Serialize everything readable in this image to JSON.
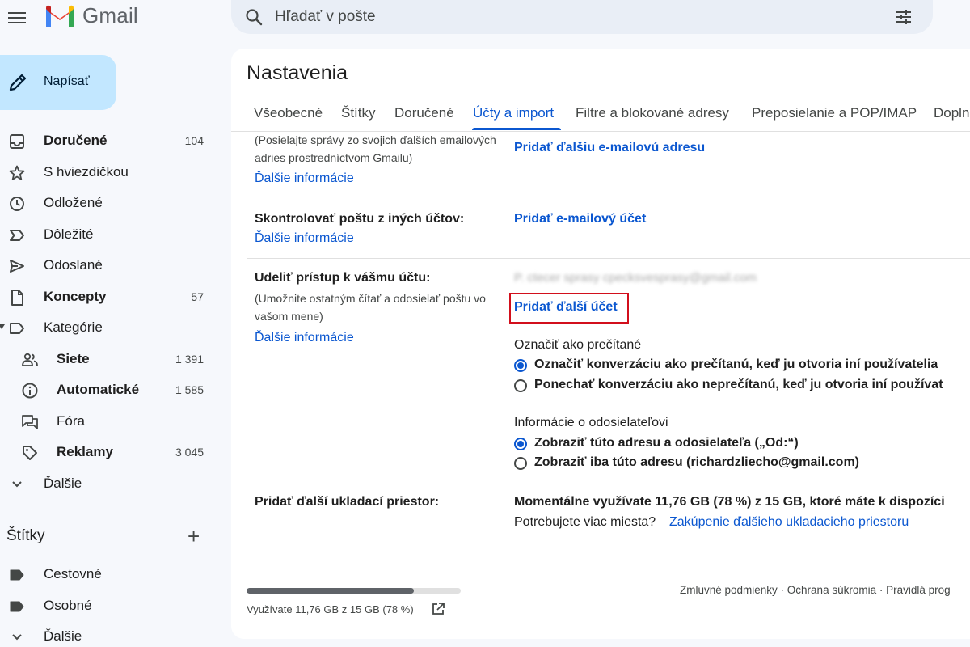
{
  "app": {
    "name": "Gmail"
  },
  "search": {
    "placeholder": "Hľadať v pošte"
  },
  "compose": {
    "label": "Napísať"
  },
  "nav": {
    "items": [
      {
        "label": "Doručené",
        "count": "104",
        "bold": true
      },
      {
        "label": "S hviezdičkou",
        "count": "",
        "bold": false
      },
      {
        "label": "Odložené",
        "count": "",
        "bold": false
      },
      {
        "label": "Dôležité",
        "count": "",
        "bold": false
      },
      {
        "label": "Odoslané",
        "count": "",
        "bold": false
      },
      {
        "label": "Koncepty",
        "count": "57",
        "bold": true
      },
      {
        "label": "Kategórie",
        "count": "",
        "bold": false
      },
      {
        "label": "Siete",
        "count": "1 391",
        "bold": true
      },
      {
        "label": "Automatické",
        "count": "1 585",
        "bold": true
      },
      {
        "label": "Fóra",
        "count": "",
        "bold": false
      },
      {
        "label": "Reklamy",
        "count": "3 045",
        "bold": true
      },
      {
        "label": "Ďalšie",
        "count": "",
        "bold": false
      }
    ]
  },
  "labels": {
    "title": "Štítky",
    "add": "+",
    "items": [
      {
        "label": "Cestovné"
      },
      {
        "label": "Osobné"
      },
      {
        "label": "Ďalšie"
      }
    ]
  },
  "settings": {
    "title": "Nastavenia",
    "tabs": [
      {
        "label": "Všeobecné"
      },
      {
        "label": "Štítky"
      },
      {
        "label": "Doručené"
      },
      {
        "label": "Účty a import"
      },
      {
        "label": "Filtre a blokované adresy"
      },
      {
        "label": "Preposielanie a POP/IMAP"
      },
      {
        "label": "Dopln"
      }
    ],
    "active_tab": "Účty a import",
    "send_as": {
      "description_line1": "(Posielajte správy zo svojich ďalších emailových",
      "description_line2": "adries prostredníctvom Gmailu)",
      "more_info": "Ďalšie informácie",
      "action": "Pridať ďalšiu e-mailovú adresu"
    },
    "check_mail": {
      "label": "Skontrolovať poštu z iných účtov:",
      "more_info": "Ďalšie informácie",
      "action": "Pridať e-mailový účet"
    },
    "grant_access": {
      "label": "Udeliť prístup k vášmu účtu:",
      "description_line1": "(Umožnite ostatným čítať a odosielať poštu vo",
      "description_line2": "vašom mene)",
      "more_info": "Ďalšie informácie",
      "blurred_email": "P. ctecer sprasy cpecksvesprasy@gmail.com",
      "action": "Pridať ďalší účet",
      "mark_read": {
        "title": "Označiť ako prečítané",
        "options": [
          {
            "label": "Označiť konverzáciu ako prečítanú, keď ju otvoria iní používatelia",
            "checked": true
          },
          {
            "label": "Ponechať konverzáciu ako neprečítanú, keď ju otvoria iní používat",
            "checked": false
          }
        ]
      },
      "sender_info": {
        "title": "Informácie o odosielateľovi",
        "options": [
          {
            "label": "Zobraziť túto adresu a odosielateľa („Od:“)",
            "checked": true
          },
          {
            "label": "Zobraziť iba túto adresu (richardzliecho@gmail.com)",
            "checked": false
          }
        ]
      }
    },
    "storage": {
      "label": "Pridať ďalší ukladací priestor:",
      "usage_text": "Momentálne využívate 11,76 GB (78 %) z 15 GB, ktoré máte k dispozíci",
      "need_more": "Potrebujete viac miesta?",
      "purchase_link": "Zakúpenie ďalšieho ukladacieho priestoru"
    },
    "footer": {
      "storage_used_fraction": 0.78,
      "storage_text": "Využívate 11,76 GB z 15 GB (78 %)",
      "links": "Zmluvné podmienky · Ochrana súkromia · Pravidlá prog"
    }
  },
  "colors": {
    "accent": "#0b57d0",
    "compose_bg": "#c2e7ff",
    "search_bg": "#e9eef6",
    "highlight": "#d20f1c"
  }
}
